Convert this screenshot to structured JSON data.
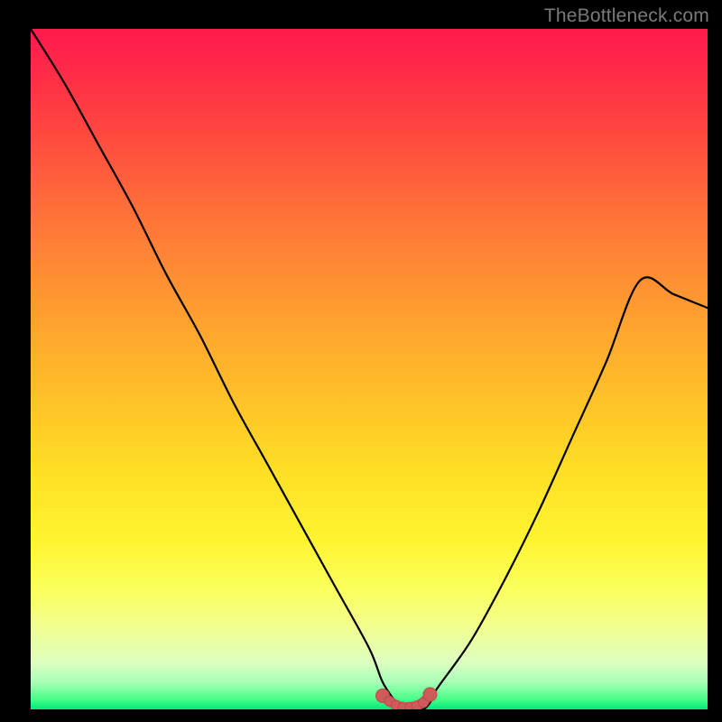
{
  "watermark": "TheBottleneck.com",
  "colors": {
    "frame": "#000000",
    "curve": "#000000",
    "marker_fill": "#cf5a5a",
    "marker_stroke": "#b94c4c",
    "gradient_stops": [
      "#ff1a4d",
      "#ff2a48",
      "#ff4740",
      "#ff6a3a",
      "#ff8a34",
      "#ffa72e",
      "#ffc328",
      "#ffdf24",
      "#fff430",
      "#fbff5a",
      "#f2ff90",
      "#deffc0",
      "#a8ffb8",
      "#48ff88",
      "#00e87a"
    ]
  },
  "chart_data": {
    "type": "line",
    "title": "",
    "xlabel": "",
    "ylabel": "",
    "xlim": [
      0,
      100
    ],
    "ylim": [
      0,
      100
    ],
    "grid": false,
    "legend": false,
    "series": [
      {
        "name": "bottleneck-curve",
        "x": [
          0,
          5,
          10,
          15,
          20,
          25,
          30,
          35,
          40,
          45,
          50,
          52,
          54,
          55,
          56,
          57,
          58,
          59,
          60,
          65,
          70,
          75,
          80,
          85,
          90,
          95,
          100
        ],
        "y": [
          100,
          92,
          83,
          74,
          64,
          55,
          45,
          36,
          27,
          18,
          9,
          4,
          1,
          0,
          0,
          0,
          0,
          1,
          3,
          10,
          19,
          29,
          40,
          51,
          63,
          61,
          59
        ]
      }
    ],
    "markers": {
      "name": "lowest-bottleneck-range",
      "x_range": [
        52,
        59
      ],
      "points": [
        {
          "x": 52.0,
          "y": 2.0
        },
        {
          "x": 53.0,
          "y": 1.2
        },
        {
          "x": 54.0,
          "y": 0.6
        },
        {
          "x": 55.0,
          "y": 0.3
        },
        {
          "x": 56.0,
          "y": 0.3
        },
        {
          "x": 57.0,
          "y": 0.5
        },
        {
          "x": 58.0,
          "y": 1.0
        },
        {
          "x": 59.0,
          "y": 2.2
        }
      ]
    }
  }
}
